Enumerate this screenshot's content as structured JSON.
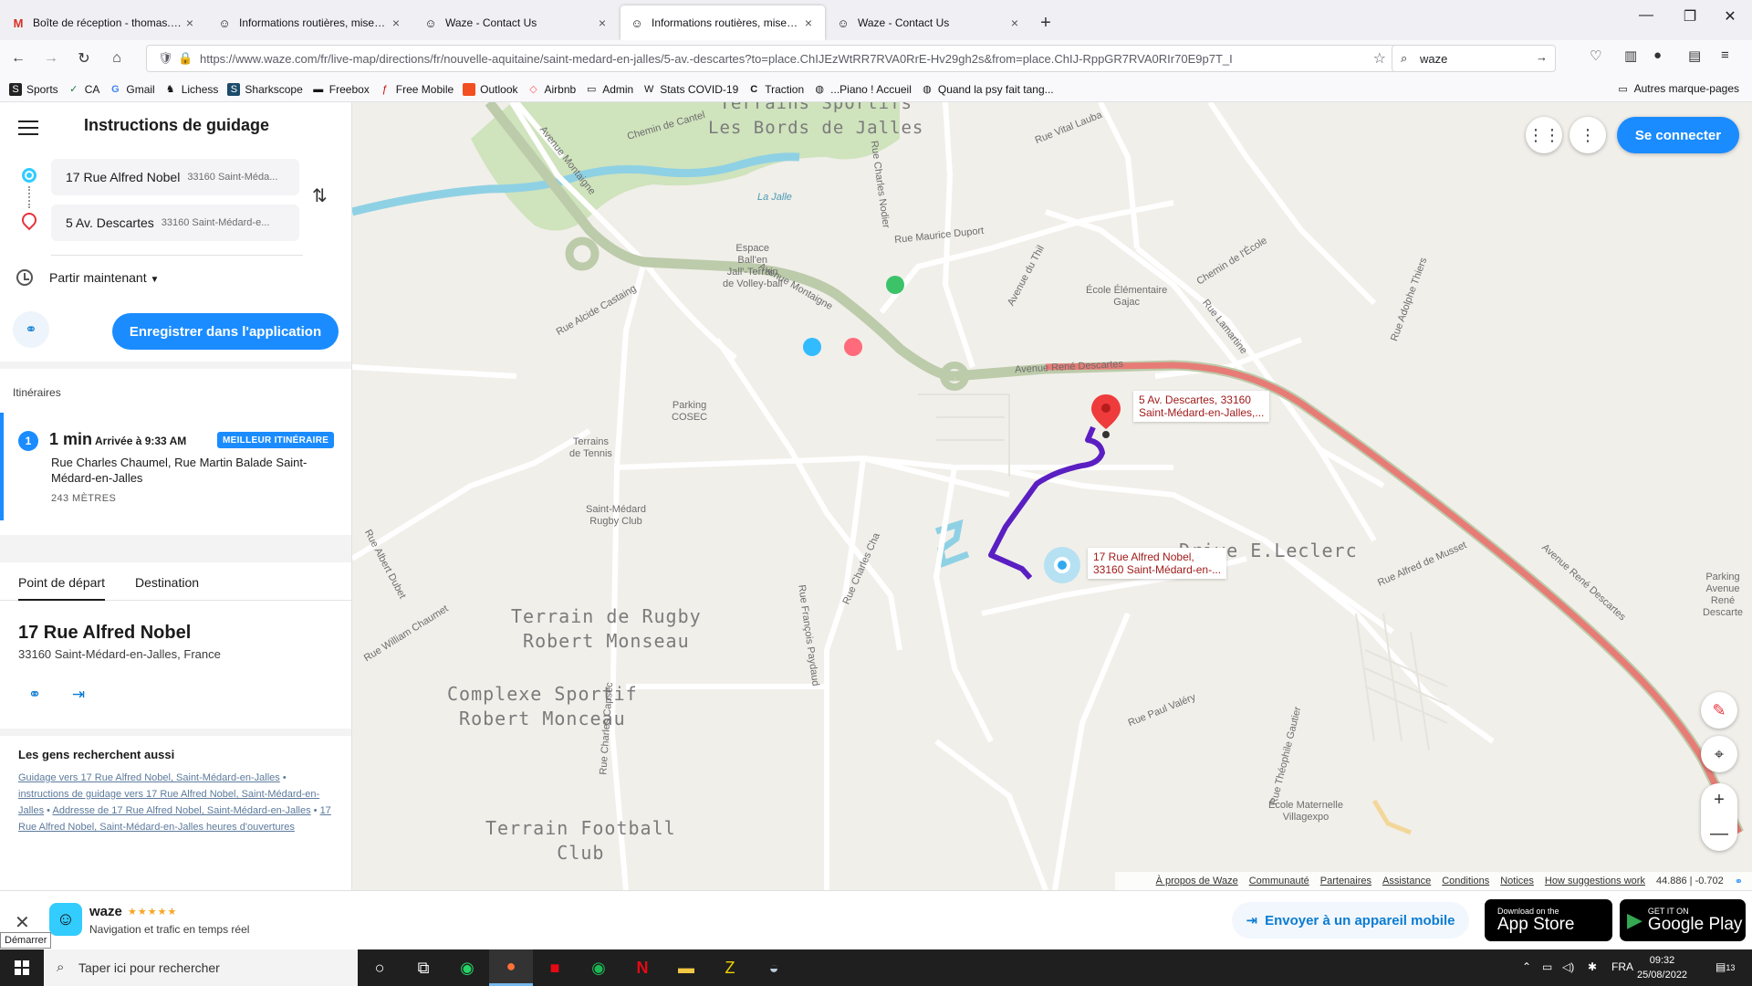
{
  "browser": {
    "tabs": [
      {
        "label": "Boîte de réception - thomas.gui",
        "icon": "gmail-icon",
        "active": false
      },
      {
        "label": "Informations routières, mises à",
        "icon": "waze-icon",
        "active": false
      },
      {
        "label": "Waze - Contact Us",
        "icon": "waze-icon",
        "active": false
      },
      {
        "label": "Informations routières, mises à",
        "icon": "waze-icon",
        "active": true
      },
      {
        "label": "Waze - Contact Us",
        "icon": "waze-icon",
        "active": false
      }
    ],
    "url": "https://www.waze.com/fr/live-map/directions/fr/nouvelle-aquitaine/saint-medard-en-jalles/5-av.-descartes?to=place.ChIJEzWtRR7RVA0RrE-Hv29gh2s&from=place.ChIJ-RppGR7RVA0RIr70E9p7T_I",
    "search_query": "waze",
    "bookmarks": [
      "Sports",
      "CA",
      "Gmail",
      "Lichess",
      "Sharkscope",
      "Freebox",
      "Free Mobile",
      "Outlook",
      "Airbnb",
      "Admin",
      "Stats COVID-19",
      "Traction",
      "...Piano ! Accueil",
      "Quand la psy fait tang..."
    ],
    "bookmarks_other": "Autres marque-pages"
  },
  "panel": {
    "title": "Instructions de guidage",
    "from": {
      "main": "17 Rue Alfred Nobel",
      "sub": "33160 Saint-Méda..."
    },
    "to": {
      "main": "5 Av. Descartes",
      "sub": "33160 Saint-Médard-e..."
    },
    "depart": "Partir maintenant",
    "save_app": "Enregistrer dans l'application",
    "itineraries_heading": "Itinéraires",
    "route": {
      "number": "1",
      "duration": "1 min",
      "arrival": "Arrivée à 9:33 AM",
      "badge": "MEILLEUR ITINÉRAIRE",
      "description": "Rue Charles Chaumel, Rue Martin Balade Saint-Médard-en-Jalles",
      "distance": "243 MÈTRES"
    },
    "tabs": [
      "Point de départ",
      "Destination"
    ],
    "address_title": "17 Rue Alfred Nobel",
    "address_sub": "33160 Saint-Médard-en-Jalles, France",
    "also_heading": "Les gens recherchent aussi",
    "also_links": [
      "Guidage vers 17 Rue Alfred Nobel, Saint-Médard-en-Jalles",
      "instructions de guidage vers 17 Rue Alfred Nobel, Saint-Médard-en-Jalles",
      "Addresse de 17 Rue Alfred Nobel, Saint-Médard-en-Jalles",
      "17 Rue Alfred Nobel, Saint-Médard-en-Jalles heures d'ouvertures"
    ]
  },
  "map": {
    "connect": "Se connecter",
    "dest_label_1": "5 Av. Descartes, 33160",
    "dest_label_2": "Saint-Médard-en-Jalles,...",
    "start_label_1": "17 Rue Alfred Nobel,",
    "start_label_2": "33160 Saint-Médard-en-...",
    "big_labels": {
      "rugby": [
        "Terrain de Rugby",
        "Robert Monseau"
      ],
      "complexe": [
        "Complexe Sportif",
        "Robert Monceau"
      ],
      "football": [
        "Terrain Football",
        "Club"
      ],
      "jalles": [
        "Terrains Sportifs",
        "Les Bords de Jalles"
      ],
      "leclerc": "Drive E.Leclerc"
    },
    "small_labels": {
      "espace": "Espace\nBall'en\nJall'-Terrain\nde Volley-ball",
      "parking_cosec": "Parking\nCOSEC",
      "tennis": "Terrains\nde Tennis",
      "rugby_club": "Saint-Médard\nRugby Club",
      "ecole_gajac": "École Élémentaire\nGajac",
      "ecole_villagexpo": "École Maternelle\nVillagexpo",
      "parking_rene": "Parking\nAvenue\nRené Descarte",
      "la_jalle": "La Jalle"
    },
    "streets": {
      "montaigne1": "Avenue Montaigne",
      "montaigne2": "Avenue Montaigne",
      "alcide": "Rue Alcide Castaing",
      "maurice": "Rue Maurice Duport",
      "vital": "Rue Vital Lauba",
      "nodier": "Rue Charles Nodier",
      "thil": "Avenue du Thil",
      "ecole": "Chemin de l'École",
      "lamartine": "Rue Lamartine",
      "thiers": "Rue Adolphe Thiers",
      "rene1": "Avenue René Descartes",
      "rene2": "Avenue René Descartes",
      "musset": "Rue Alfred de Musset",
      "chaumel": "Rue Charles Cha",
      "paydaud": "Rue François Paydaud",
      "capsec": "Rue Charles Capsec",
      "william": "Rue William Chaumet",
      "albert": "Rue Albert Dubet",
      "paul": "Rue Paul Valéry",
      "gautier": "Rue Théophile Gautier",
      "cantelou": "Chemin de Cantel"
    },
    "footer_links": [
      "À propos de Waze",
      "Communauté",
      "Partenaires",
      "Assistance",
      "Conditions",
      "Notices",
      "How suggestions work"
    ],
    "coords": "44.886 | -0.702"
  },
  "promo": {
    "name": "waze",
    "stars": "★★★★★",
    "subtitle": "Navigation et trafic en temps réel",
    "send": "Envoyer à un appareil mobile",
    "appstore_small": "Download on the",
    "appstore_big": "App Store",
    "googleplay_small": "GET IT ON",
    "googleplay_big": "Google Play",
    "tooltip": "Démarrer"
  },
  "taskbar": {
    "search_placeholder": "Taper ici pour rechercher",
    "lang": "FRA",
    "time": "09:32",
    "date": "25/08/2022",
    "notif": "13"
  },
  "colors": {
    "accent": "#1a8cff",
    "route": "#5a1fc2",
    "traffic": "#ef6f6f",
    "main_road": "#bccbaa",
    "park": "#cfe3bd",
    "water": "#8fd1e4"
  }
}
